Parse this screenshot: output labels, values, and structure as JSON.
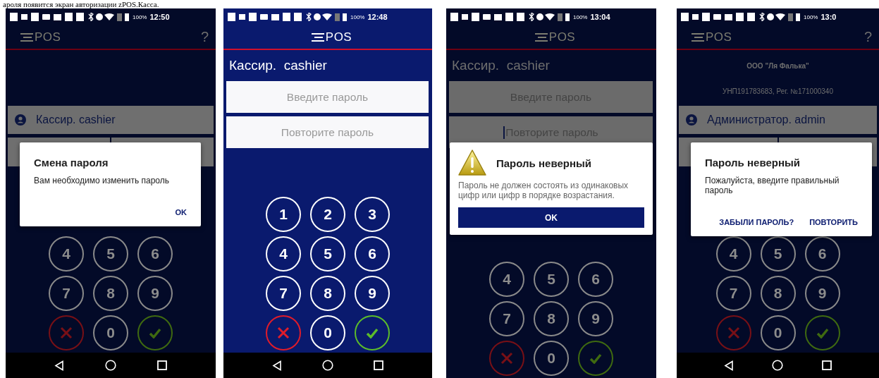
{
  "caption": "ароля появится экран авторизации zPOS.Касса.",
  "phones": [
    {
      "kind": "login",
      "dimmed": true,
      "status": {
        "battery": "100%",
        "time": "12:50"
      },
      "header": {
        "logo": "POS",
        "help": "?"
      },
      "user": "Кассир. cashier",
      "keypad": [
        {
          "kind": "digit",
          "label": "4"
        },
        {
          "kind": "digit",
          "label": "5"
        },
        {
          "kind": "digit",
          "label": "6"
        },
        {
          "kind": "digit",
          "label": "7"
        },
        {
          "kind": "digit",
          "label": "8"
        },
        {
          "kind": "digit",
          "label": "9"
        },
        {
          "kind": "cancel"
        },
        {
          "kind": "digit",
          "label": "0"
        },
        {
          "kind": "confirm"
        }
      ],
      "dialog": {
        "kind": "plain",
        "title": "Смена пароля",
        "message": "Вам необходимо изменить пароль",
        "buttons": [
          {
            "kind": "text",
            "label": "OK"
          }
        ]
      },
      "nav_bar": true
    },
    {
      "kind": "set_password",
      "dimmed": false,
      "status": {
        "battery": "100%",
        "time": "12:48"
      },
      "header": {
        "logo": "POS"
      },
      "title": "Кассир.  cashier",
      "fields": [
        {
          "placeholder": "Введите пароль",
          "focused": false
        },
        {
          "placeholder": "Повторите пароль",
          "focused": false
        }
      ],
      "keypad": [
        {
          "kind": "digit",
          "label": "1"
        },
        {
          "kind": "digit",
          "label": "2"
        },
        {
          "kind": "digit",
          "label": "3"
        },
        {
          "kind": "digit",
          "label": "4"
        },
        {
          "kind": "digit",
          "label": "5"
        },
        {
          "kind": "digit",
          "label": "6"
        },
        {
          "kind": "digit",
          "label": "7"
        },
        {
          "kind": "digit",
          "label": "8"
        },
        {
          "kind": "digit",
          "label": "9"
        },
        {
          "kind": "cancel"
        },
        {
          "kind": "digit",
          "label": "0"
        },
        {
          "kind": "confirm"
        }
      ],
      "nav_bar": true
    },
    {
      "kind": "set_password",
      "dimmed": true,
      "status": {
        "battery": "100%",
        "time": "13:04"
      },
      "header": {
        "logo": "POS"
      },
      "title": "Кассир.  cashier",
      "fields": [
        {
          "placeholder": "Введите пароль",
          "focused": false
        },
        {
          "placeholder": "Повторите пароль",
          "focused": true
        }
      ],
      "keypad": [
        {
          "kind": "digit",
          "label": "4"
        },
        {
          "kind": "digit",
          "label": "5"
        },
        {
          "kind": "digit",
          "label": "6"
        },
        {
          "kind": "digit",
          "label": "7"
        },
        {
          "kind": "digit",
          "label": "8"
        },
        {
          "kind": "digit",
          "label": "9"
        },
        {
          "kind": "cancel"
        },
        {
          "kind": "digit",
          "label": "0"
        },
        {
          "kind": "confirm"
        }
      ],
      "dialog": {
        "kind": "warning",
        "title": "Пароль неверный",
        "message": "Пароль не должен состоять из одинаковых цифр или цифр в порядке возрастания.",
        "buttons": [
          {
            "kind": "filled",
            "label": "OK"
          }
        ]
      },
      "nav_bar": false
    },
    {
      "kind": "login",
      "dimmed": true,
      "status": {
        "battery": "100%",
        "time": "13:0"
      },
      "header": {
        "logo": "POS",
        "help": "?"
      },
      "org_lines": [
        {
          "kind": "name",
          "text": "ООО \"Ля Фалька\""
        },
        {
          "kind": "id",
          "text": "УНП191783683, Рег. №171000340"
        }
      ],
      "user": "Администратор. admin",
      "keypad": [
        {
          "kind": "digit",
          "label": "4"
        },
        {
          "kind": "digit",
          "label": "5"
        },
        {
          "kind": "digit",
          "label": "6"
        },
        {
          "kind": "digit",
          "label": "7"
        },
        {
          "kind": "digit",
          "label": "8"
        },
        {
          "kind": "digit",
          "label": "9"
        },
        {
          "kind": "cancel"
        },
        {
          "kind": "digit",
          "label": "0"
        },
        {
          "kind": "confirm"
        }
      ],
      "dialog": {
        "kind": "plain",
        "title": "Пароль неверный",
        "message": "Пожалуйста, введите правильный пароль",
        "buttons": [
          {
            "kind": "text",
            "label": "ЗАБЫЛИ ПАРОЛЬ?"
          },
          {
            "kind": "text",
            "label": "ПОВТОРИТЬ"
          }
        ]
      },
      "nav_bar": true
    }
  ]
}
